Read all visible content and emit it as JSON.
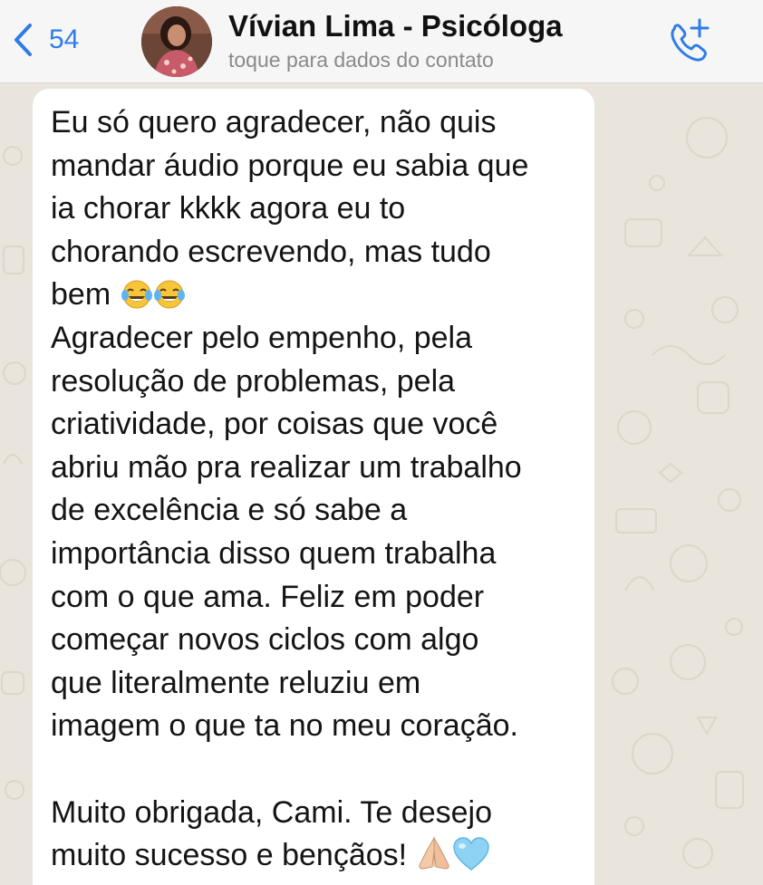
{
  "header": {
    "back_count": "54",
    "contact_name": "Vívian Lima - Psicóloga",
    "contact_subtitle": "toque para dados do contato",
    "back_icon": "chevron-left-icon",
    "call_icon": "add-call-icon",
    "accent_color": "#2f7ce8"
  },
  "message": {
    "lines": [
      "Eu só quero agradecer, não quis",
      "mandar áudio porque eu sabia que",
      "ia chorar kkkk agora eu to",
      "chorando escrevendo, mas tudo",
      "bem ",
      "Agradecer pelo empenho, pela",
      "resolução de problemas, pela",
      "criatividade, por coisas que você",
      "abriu mão pra realizar um trabalho",
      "de excelência e só sabe a",
      "importância disso quem trabalha",
      "com o que ama. Feliz em poder",
      "começar novos ciclos com algo",
      "que literalmente reluziu em",
      "imagem o que ta no meu coração.",
      "",
      "Muito obrigada, Cami. Te desejo",
      "muito sucesso e bençãos! "
    ],
    "emojis": {
      "line_5": [
        "face-with-tears-of-joy",
        "face-with-tears-of-joy"
      ],
      "line_18": [
        "folded-hands",
        "light-blue-heart"
      ]
    }
  }
}
